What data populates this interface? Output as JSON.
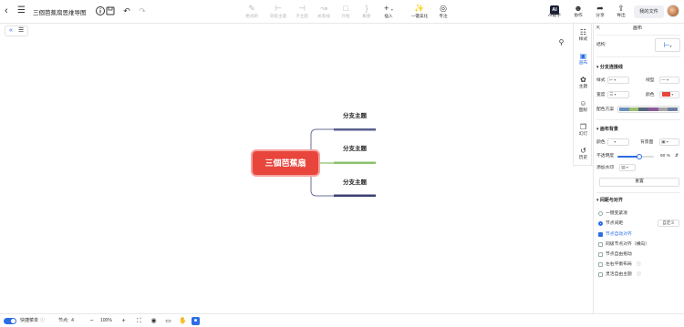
{
  "document": {
    "title": "三個芭蕉扇思维导图"
  },
  "toolbar": {
    "center_tools": [
      {
        "label": "格式刷",
        "icon": "format-painter-icon",
        "enabled": false
      },
      {
        "label": "同级主题",
        "icon": "sibling-topic-icon",
        "enabled": false
      },
      {
        "label": "子主题",
        "icon": "child-topic-icon",
        "enabled": false
      },
      {
        "label": "关系线",
        "icon": "relation-line-icon",
        "enabled": false
      },
      {
        "label": "外框",
        "icon": "boundary-icon",
        "enabled": false
      },
      {
        "label": "概要",
        "icon": "summary-icon",
        "enabled": false
      },
      {
        "label": "插入",
        "icon": "insert-icon",
        "enabled": true
      },
      {
        "label": "一键美化",
        "icon": "beautify-icon",
        "enabled": true
      },
      {
        "label": "专注",
        "icon": "focus-icon",
        "enabled": true
      }
    ],
    "right_tools": [
      {
        "label": "AI助手",
        "icon": "ai-assistant-icon"
      },
      {
        "label": "协作",
        "icon": "collaborate-icon"
      },
      {
        "label": "分享",
        "icon": "share-icon"
      },
      {
        "label": "导出",
        "icon": "export-icon"
      }
    ],
    "my_files": "我的文件"
  },
  "side_tabs": [
    {
      "label": "样式",
      "icon": "style-icon",
      "active": false
    },
    {
      "label": "画布",
      "icon": "canvas-icon",
      "active": true
    },
    {
      "label": "主题",
      "icon": "theme-icon",
      "active": false
    },
    {
      "label": "图标",
      "icon": "icons-icon",
      "active": false
    },
    {
      "label": "幻灯",
      "icon": "slides-icon",
      "active": false
    },
    {
      "label": "历史",
      "icon": "history-icon",
      "active": false
    }
  ],
  "panel": {
    "title": "画布",
    "structure_label": "结构",
    "branch_section": "分支连接线",
    "style_label": "样式",
    "line_type_label": "线型",
    "width_label": "宽度",
    "color_label": "颜色",
    "palette_label": "配色方案",
    "branch_color": "#e8453c",
    "palette_colors": [
      "#6b8fbf",
      "#9dc06a",
      "#58677c",
      "#8e5a96",
      "#a6a6a6",
      "#6e7fa3"
    ],
    "canvas_section": "画布背景",
    "bg_color_label": "颜色",
    "bg_image_label": "背景图",
    "opacity_label": "不透明度",
    "opacity_value": "60",
    "opacity_unit": "%",
    "opacity_fraction": 0.6,
    "watermark_label": "添加水印",
    "reset_button": "重置",
    "layout_section": "间距与对齐",
    "auto_balance": "一键变紧凑",
    "node_spacing": "节点间距",
    "custom_button": "自定义",
    "options": [
      {
        "label": "节点自动对齐",
        "checked": true
      },
      {
        "label": "同级节点对齐（横向）",
        "checked": false
      },
      {
        "label": "节点自由拖动",
        "checked": false
      },
      {
        "label": "左右平衡布局",
        "checked": false
      },
      {
        "label": "灵活自由主题",
        "checked": false
      }
    ]
  },
  "mindmap": {
    "root": "三個芭蕉扇",
    "branches": [
      {
        "label": "分支主题",
        "color": "#5b5f8f"
      },
      {
        "label": "分支主题",
        "color": "#8dc06b"
      },
      {
        "label": "分支主题",
        "color": "#3d3f73"
      }
    ]
  },
  "bottom": {
    "quick_start": "快捷菜单",
    "node_count_label": "节点:",
    "node_count": "4",
    "zoom": "100%"
  }
}
